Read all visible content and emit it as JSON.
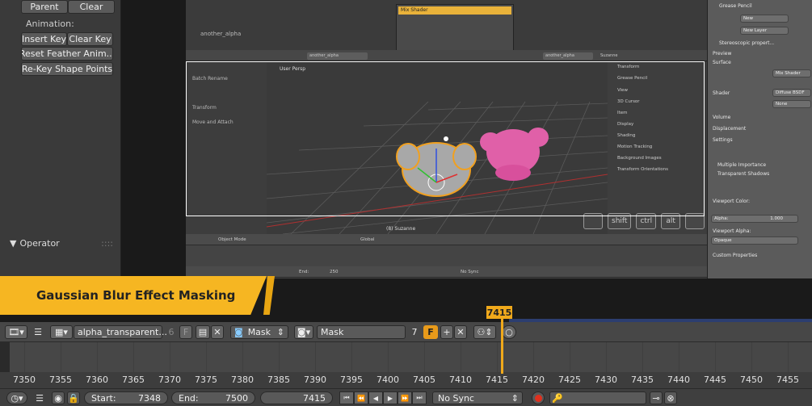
{
  "left_panel": {
    "buttons_row1": [
      "Parent",
      "Clear"
    ],
    "animation_label": "Animation:",
    "buttons_row2": [
      "Insert Key",
      "Clear Key"
    ],
    "reset_button": "Reset Feather Anim...",
    "rekey_button": "Re-Key Shape Points",
    "operator_label": "Operator"
  },
  "embedded": {
    "node_name": "another_alpha",
    "mix_shader": "Mix Shader",
    "header_left_field": "another_alpha",
    "header_right_field": "another_alpha",
    "header_object": "Suzanne",
    "tool_items": [
      "Batch Rename",
      "Transform",
      "Move and Attach"
    ],
    "viewport_label": "User Persp",
    "object_label": "(8) Suzanne",
    "right_items": [
      "Transform",
      "Grease Pencil",
      "View",
      "3D Cursor",
      "Item",
      "Display",
      "Shading",
      "Motion Tracking",
      "Background Images",
      "Transform Orientations"
    ],
    "bottom_mode": "Object Mode",
    "bottom_space": "Global",
    "bottom_end_label": "End:",
    "bottom_end_value": "250",
    "bottom_sync": "No Sync",
    "keys": [
      "shift",
      "ctrl",
      "alt"
    ]
  },
  "properties": {
    "grease_label": "Grease Pencil",
    "new_button": "New",
    "new_layer": "New Layer",
    "stereo": "Stereoscopic propert...",
    "material": "another_alpha",
    "preview": "Preview",
    "surface": "Surface",
    "surface_value": "Mix Shader",
    "shader": "Shader",
    "shader_value": "Diffuse BSDF",
    "shader2_value": "None",
    "volume": "Volume",
    "displacement": "Displacement",
    "settings": "Settings",
    "multiple_importance": "Multiple Importance",
    "transparent_shadows": "Transparent Shadows",
    "viewport_color": "Viewport Color:",
    "alpha_label": "Alpha:",
    "alpha_value": "1.000",
    "viewport_alpha": "Viewport Alpha:",
    "opaque": "Opaque",
    "custom_properties": "Custom Properties"
  },
  "banner": {
    "title": "Gaussian Blur Effect Masking"
  },
  "current_frame": "7415",
  "mask_header": {
    "clip_name": "alpha_transparent...",
    "clip_users": "6",
    "fake_user": "F",
    "mode": "Mask",
    "mask_name": "Mask",
    "mask_users": "7",
    "mask_fake": "F"
  },
  "timeline": {
    "ticks": [
      "7350",
      "7355",
      "7360",
      "7365",
      "7370",
      "7375",
      "7380",
      "7385",
      "7390",
      "7395",
      "7400",
      "7405",
      "7410",
      "7415",
      "7420",
      "7425",
      "7430",
      "7435",
      "7440",
      "7445",
      "7450",
      "7455"
    ]
  },
  "playback": {
    "start_label": "Start:",
    "start_value": "7348",
    "end_label": "End:",
    "end_value": "7500",
    "frame_value": "7415",
    "sync": "No Sync"
  },
  "colors": {
    "accent": "#f6b622",
    "frame_indicator": "#f0a91b",
    "record": "#e0301e"
  }
}
